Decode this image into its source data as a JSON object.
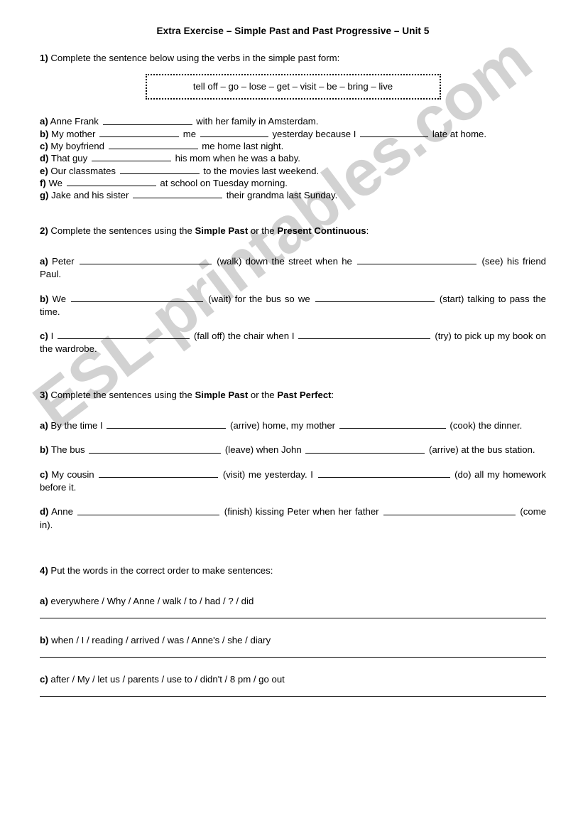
{
  "document": {
    "title": "Extra Exercise – Simple Past and Past Progressive – Unit 5",
    "watermark": "ESL-printables.com",
    "watermark_color": "#d2d2d2"
  },
  "exercise1": {
    "number": "1)",
    "instruction": "Complete the sentence below using the verbs in the simple past form:",
    "word_bank": "tell off – go – lose – get –  visit – be – bring – live",
    "items": [
      {
        "label": "a)",
        "part1": "Anne Frank",
        "part2": "with her family in Amsterdam."
      },
      {
        "label": "b)",
        "part1": "My mother",
        "part2": "me",
        "part3": "yesterday because I",
        "part4": "late at home."
      },
      {
        "label": "c)",
        "part1": "My boyfriend",
        "part2": "me home last night."
      },
      {
        "label": "d)",
        "part1": "That guy",
        "part2": "his mom when he was a baby."
      },
      {
        "label": "e)",
        "part1": "Our classmates",
        "part2": "to the movies last weekend."
      },
      {
        "label": "f)",
        "part1": "We",
        "part2": "at school on Tuesday morning."
      },
      {
        "label": "g)",
        "part1": "Jake and his sister",
        "part2": "their grandma last Sunday."
      }
    ]
  },
  "exercise2": {
    "number": "2)",
    "instruction_pre": "Complete the sentences using the ",
    "tense1": "Simple Past",
    "instruction_mid": " or the ",
    "tense2": "Present Continuous",
    "instruction_post": ":",
    "items": [
      {
        "label": "a)",
        "part1": "Peter",
        "cue1": "(walk) down the street when he",
        "cue2": "(see) his friend Paul."
      },
      {
        "label": "b)",
        "part1": "We",
        "cue1": "(wait) for the bus so we",
        "cue2": "(start) talking to pass the time."
      },
      {
        "label": "c)",
        "part1": "I",
        "cue1": "(fall off) the chair when I",
        "cue2": "(try) to pick up my book on the wardrobe."
      }
    ]
  },
  "exercise3": {
    "number": "3)",
    "instruction_pre": "Complete the sentences using the ",
    "tense1": "Simple Past",
    "instruction_mid": " or the ",
    "tense2": "Past Perfect",
    "instruction_post": ":",
    "items": [
      {
        "label": "a)",
        "part1": "By the time I",
        "cue1": "(arrive) home, my mother",
        "cue2": "(cook) the dinner."
      },
      {
        "label": "b)",
        "part1": "The bus",
        "cue1": "(leave) when John",
        "cue2": "(arrive) at the bus station."
      },
      {
        "label": "c)",
        "part1": "My cousin",
        "cue1": "(visit) me yesterday. I",
        "cue2": "(do) all my homework before it."
      },
      {
        "label": "d)",
        "part1": "Anne",
        "cue1": "(finish) kissing Peter when her father",
        "cue2": "(come in)."
      }
    ]
  },
  "exercise4": {
    "number": "4)",
    "instruction": "Put the words in the correct order to make sentences:",
    "items": [
      {
        "label": "a)",
        "words": "everywhere / Why / Anne / walk / to / had / ? / did"
      },
      {
        "label": "b)",
        "words": "when / I / reading / arrived / was / Anne's / she / diary"
      },
      {
        "label": "c)",
        "words": "after / My / let us / parents / use to / didn't / 8 pm / go out"
      }
    ]
  }
}
